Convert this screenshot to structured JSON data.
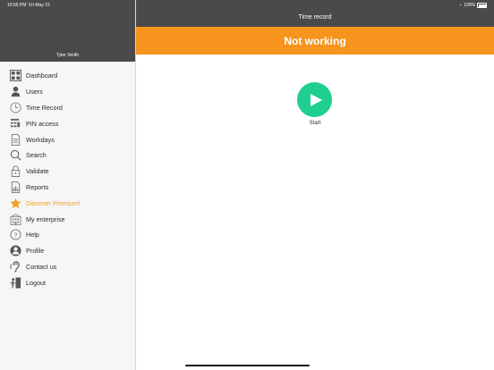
{
  "status_bar": {
    "time": "10:55 PM",
    "date": "Fri May 15",
    "battery": "100%"
  },
  "sidebar": {
    "user_name": "Tyler Smith",
    "items": [
      {
        "label": "Dashboard",
        "icon": "dashboard-icon"
      },
      {
        "label": "Users",
        "icon": "user-icon"
      },
      {
        "label": "Time Record",
        "icon": "clock-icon"
      },
      {
        "label": "PIN access",
        "icon": "keypad-icon"
      },
      {
        "label": "Workdays",
        "icon": "document-icon"
      },
      {
        "label": "Search",
        "icon": "search-icon"
      },
      {
        "label": "Validate",
        "icon": "lock-icon"
      },
      {
        "label": "Reports",
        "icon": "report-icon"
      },
      {
        "label": "Discover Premium!",
        "icon": "star-icon"
      },
      {
        "label": "My enterprise",
        "icon": "building-icon"
      },
      {
        "label": "Help",
        "icon": "question-icon"
      },
      {
        "label": "Profile",
        "icon": "profile-icon"
      },
      {
        "label": "Contact us",
        "icon": "ear-icon"
      },
      {
        "label": "Logout",
        "icon": "logout-icon"
      }
    ]
  },
  "main": {
    "title": "Time record",
    "status": "Not working",
    "start_label": "Start"
  },
  "colors": {
    "header": "#4a4a4a",
    "status_banner": "#f7941d",
    "start_button": "#1fcf8f",
    "premium": "#f0a020"
  }
}
